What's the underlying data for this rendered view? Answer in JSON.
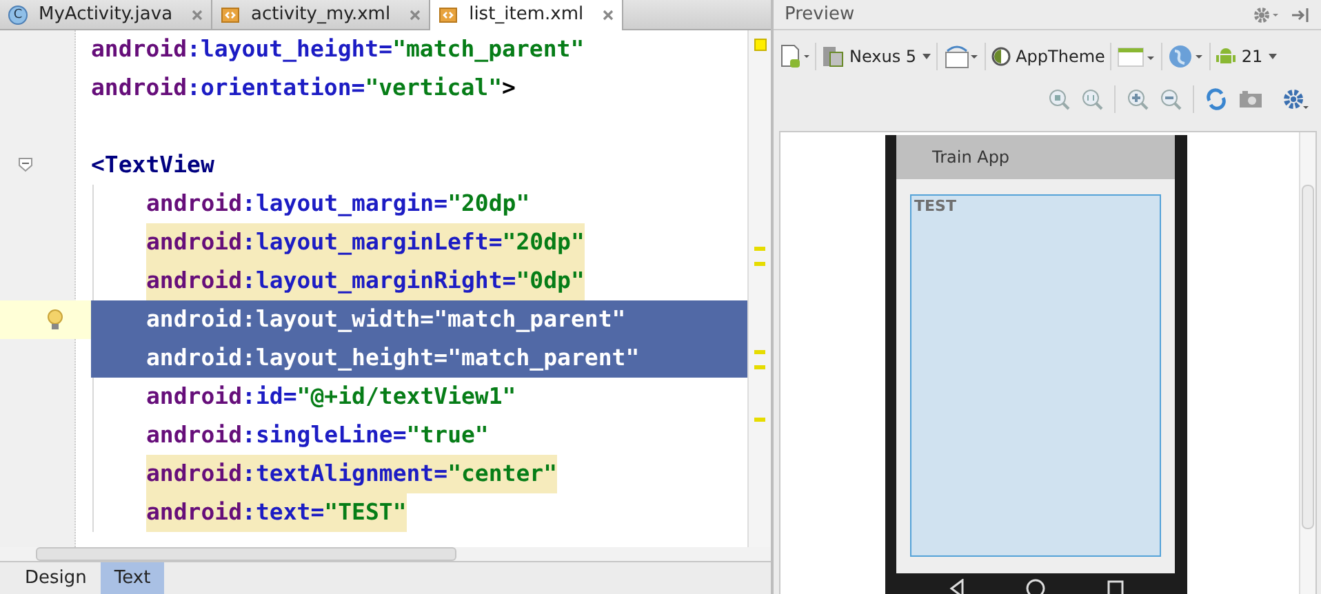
{
  "editor_tabs": [
    {
      "label": "MyActivity.java",
      "kind": "java",
      "icon_letter": "C",
      "selected": false
    },
    {
      "label": "activity_my.xml",
      "kind": "xml",
      "selected": false
    },
    {
      "label": "list_item.xml",
      "kind": "xml",
      "selected": true
    }
  ],
  "code_lines": [
    {
      "kind": "attribute",
      "namespace": "android",
      "attribute": ":layout_height=",
      "value": "\"match_parent\"",
      "warning": false,
      "selected": false,
      "current": false
    },
    {
      "kind": "attribute",
      "namespace": "android",
      "attribute": ":orientation=",
      "value": "\"vertical\"",
      "suffix": ">",
      "warning": false,
      "selected": false,
      "current": false
    },
    {
      "kind": "blank",
      "warning": false,
      "selected": false,
      "current": false
    },
    {
      "kind": "tag",
      "text": "<TextView",
      "expanded": true,
      "warning": false,
      "selected": false,
      "current": false,
      "children": [
        {
          "kind": "attribute",
          "namespace": "android",
          "attribute": ":layout_margin=",
          "value": "\"20dp\"",
          "warning": false,
          "selected": false,
          "current": false
        },
        {
          "kind": "attribute",
          "namespace": "android",
          "attribute": ":layout_marginLeft=",
          "value": "\"20dp\"",
          "warning": true,
          "selected": false,
          "current": false
        },
        {
          "kind": "attribute",
          "namespace": "android",
          "attribute": ":layout_marginRight=",
          "value": "\"0dp\"",
          "warning": true,
          "selected": false,
          "current": false
        },
        {
          "kind": "attribute",
          "namespace": "android",
          "attribute": ":layout_width=",
          "value": "\"match_parent\"",
          "warning": false,
          "selected": true,
          "current": true
        },
        {
          "kind": "attribute",
          "namespace": "android",
          "attribute": ":layout_height=",
          "value": "\"match_parent\"",
          "warning": false,
          "selected": true,
          "current": false
        },
        {
          "kind": "attribute",
          "namespace": "android",
          "attribute": ":id=",
          "value": "\"@+id/textView1\"",
          "warning": false,
          "selected": false,
          "current": false
        },
        {
          "kind": "attribute",
          "namespace": "android",
          "attribute": ":singleLine=",
          "value": "\"true\"",
          "warning": false,
          "selected": false,
          "current": false
        },
        {
          "kind": "attribute",
          "namespace": "android",
          "attribute": ":textAlignment=",
          "value": "\"center\"",
          "warning": true,
          "selected": false,
          "current": false
        },
        {
          "kind": "attribute",
          "namespace": "android",
          "attribute": ":text=",
          "value": "\"TEST\"",
          "warning": true,
          "selected": false,
          "current": false
        }
      ]
    }
  ],
  "bottom_tabs": [
    {
      "label": "Design",
      "selected": false
    },
    {
      "label": "Text",
      "selected": true
    }
  ],
  "preview": {
    "title": "Preview",
    "device": "Nexus 5",
    "theme": "AppTheme",
    "api_level": "21",
    "phone": {
      "app_title": "Train App",
      "text_view": "TEST"
    }
  }
}
